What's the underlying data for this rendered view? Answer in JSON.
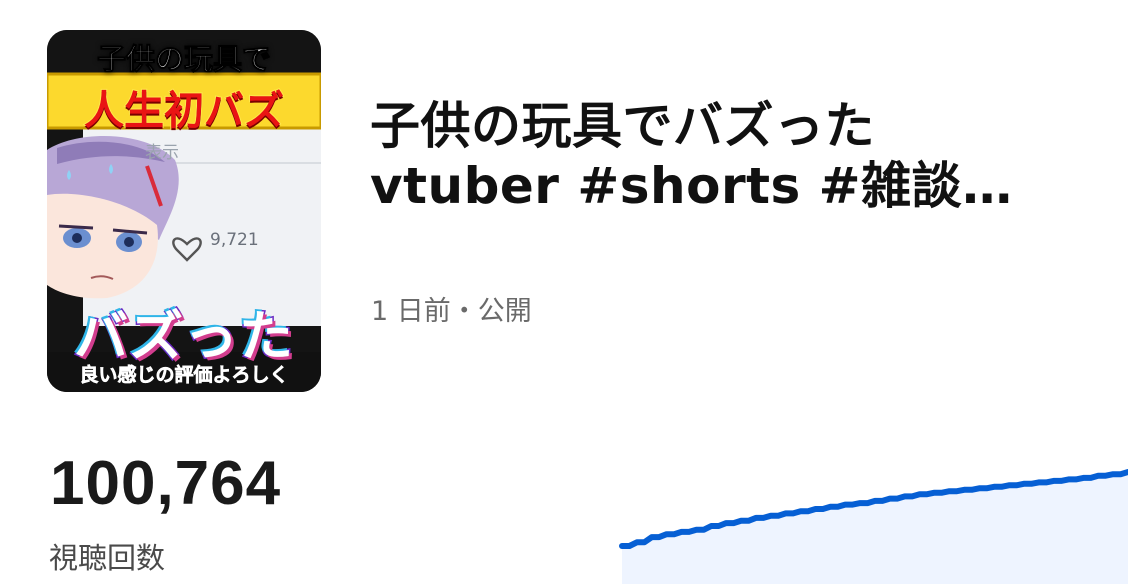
{
  "thumbnail": {
    "top_caption": "子供の玩具で",
    "banner_text": "人生初バズ",
    "display_fragment": "表示",
    "like_count": "9,721",
    "big_caption": "バズった",
    "bottom_caption": "良い感じの評価よろしく"
  },
  "video": {
    "title_line1": "子供の玩具でバズった",
    "title_line2": "vtuber #shorts #雑談…",
    "published": "1 日前・公開"
  },
  "stats": {
    "views": "100,764",
    "views_label": "視聴回数"
  },
  "chart_data": {
    "type": "area",
    "series": [
      {
        "values": [
          0,
          0.05,
          0.12,
          0.16,
          0.19,
          0.22,
          0.27,
          0.31,
          0.34,
          0.38,
          0.41,
          0.44,
          0.47,
          0.5,
          0.53,
          0.56,
          0.58,
          0.61,
          0.64,
          0.67,
          0.7,
          0.72,
          0.74,
          0.76,
          0.78,
          0.8,
          0.82,
          0.84,
          0.86,
          0.88,
          0.9,
          0.92,
          0.95,
          0.97,
          1.0
        ]
      }
    ],
    "line_color": "#065fd4",
    "fill_color": "#eef4ff",
    "grid": false
  }
}
